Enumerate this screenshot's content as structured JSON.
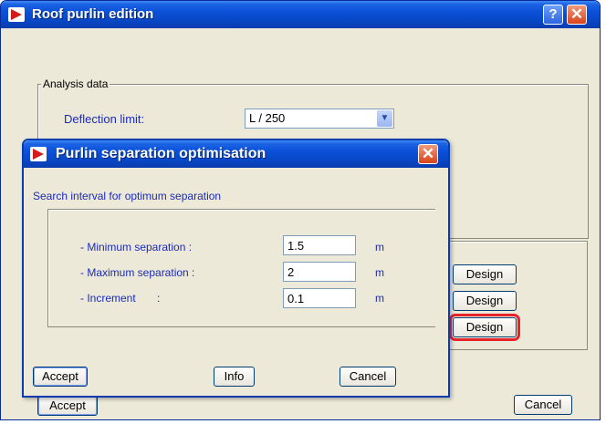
{
  "main_window": {
    "title": "Roof purlin edition",
    "analysis_group": "Analysis data",
    "deflection_label": "Deflection limit:",
    "deflection_value": "L / 250",
    "design_buttons": [
      "Design",
      "Design",
      "Design"
    ],
    "accept_label": "Accept",
    "cancel_label": "Cancel"
  },
  "dialog": {
    "title": "Purlin separation optimisation",
    "subtitle": "Search interval for optimum separation",
    "rows": [
      {
        "label": "- Minimum separation :",
        "value": "1.5",
        "unit": "m"
      },
      {
        "label": "- Maximum separation :",
        "value": "2",
        "unit": "m"
      },
      {
        "label": "- Increment       :",
        "value": "0.1",
        "unit": "m"
      }
    ],
    "accept_label": "Accept",
    "info_label": "Info",
    "cancel_label": "Cancel"
  },
  "icons": {
    "help": "help-icon",
    "close": "close-icon",
    "app": "app-icon",
    "dropdown": "chevron-down-icon"
  },
  "colors": {
    "titlebar": "#0a50d8",
    "accent_red": "#e8242b",
    "window_bg": "#ece9d8"
  }
}
